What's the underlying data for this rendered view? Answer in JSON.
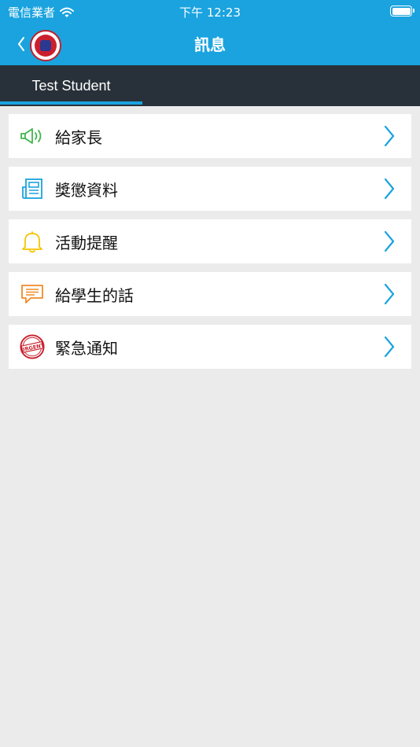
{
  "status_bar": {
    "carrier": "電信業者",
    "time": "下午 12:23"
  },
  "nav": {
    "title": "訊息",
    "back_icon": "chevron-left-icon",
    "logo": "school-crest-logo"
  },
  "tabs": [
    {
      "label": "Test Student",
      "selected": true
    }
  ],
  "menu": [
    {
      "label": "給家長",
      "icon": "megaphone-icon",
      "icon_color": "#3fb44b"
    },
    {
      "label": "獎懲資料",
      "icon": "newspaper-icon",
      "icon_color": "#1aa3df"
    },
    {
      "label": "活動提醒",
      "icon": "bell-icon",
      "icon_color": "#f5c400"
    },
    {
      "label": "給學生的話",
      "icon": "chat-bubble-icon",
      "icon_color": "#f08a24"
    },
    {
      "label": "緊急通知",
      "icon": "urgent-stamp-icon",
      "icon_color": "#c8202e"
    }
  ],
  "colors": {
    "accent": "#1aa3df",
    "tab_bar": "#283139",
    "background": "#ebebeb"
  }
}
